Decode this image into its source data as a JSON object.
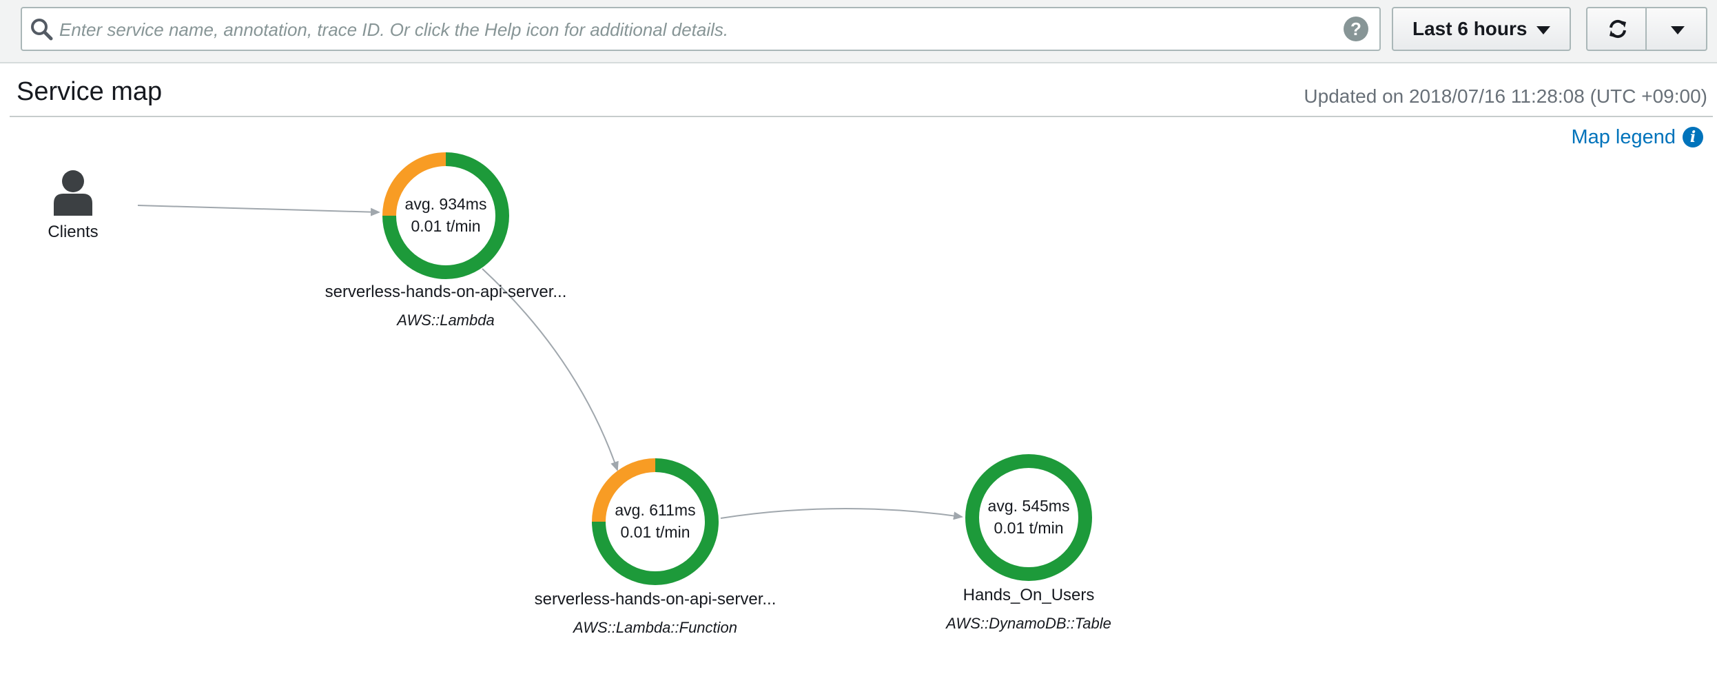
{
  "search": {
    "placeholder": "Enter service name, annotation, trace ID. Or click the Help icon for additional details.",
    "value": ""
  },
  "toolbar": {
    "time_range_label": "Last 6 hours",
    "help_glyph": "?",
    "icons": [
      "search-icon",
      "help-icon",
      "caret-down-icon",
      "refresh-icon"
    ]
  },
  "header": {
    "title": "Service map",
    "updated": "Updated on 2018/07/16 11:28:08 (UTC +09:00)"
  },
  "legend": {
    "label": "Map legend",
    "icon_glyph": "i"
  },
  "map": {
    "client": {
      "label": "Clients",
      "icon": "user-icon"
    },
    "nodes": [
      {
        "avg": "avg. 934ms",
        "rate": "0.01 t/min",
        "name": "serverless-hands-on-api-server...",
        "type": "AWS::Lambda",
        "ok_fraction": 0.75,
        "error_fraction": 0.25
      },
      {
        "avg": "avg. 611ms",
        "rate": "0.01 t/min",
        "name": "serverless-hands-on-api-server...",
        "type": "AWS::Lambda::Function",
        "ok_fraction": 0.75,
        "error_fraction": 0.25
      },
      {
        "avg": "avg. 545ms",
        "rate": "0.01 t/min",
        "name": "Hands_On_Users",
        "type": "AWS::DynamoDB::Table",
        "ok_fraction": 1.0,
        "error_fraction": 0.0
      }
    ],
    "colors": {
      "ok": "#1d9a3a",
      "error": "#f89c24",
      "edge": "#a0a7ad"
    }
  }
}
